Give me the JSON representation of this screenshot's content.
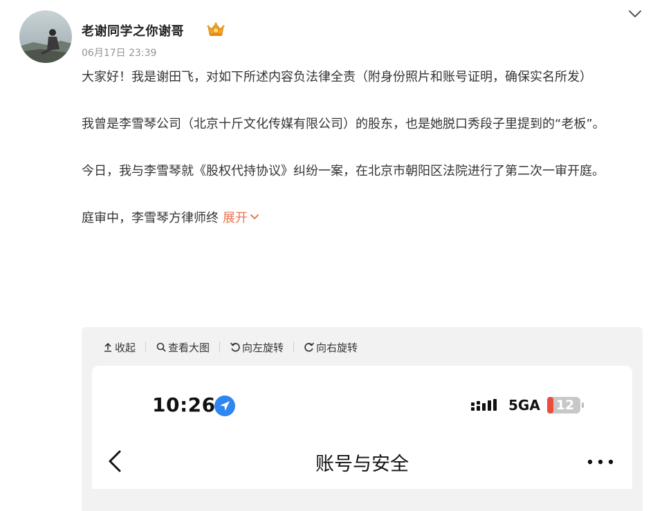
{
  "post": {
    "author": "老谢同学之你谢哥",
    "timestamp": "06月17日 23:39",
    "paragraphs": [
      "大家好！我是谢田飞，对如下所述内容负法律全责（附身份照片和账号证明，确保实名所发）",
      "我曾是李雪琴公司（北京十斤文化传媒有限公司）的股东，也是她脱口秀段子里提到的“老板”。",
      "今日，我与李雪琴就《股权代持协议》纠纷一案，在北京市朝阳区法院进行了第二次一审开庭。",
      "庭审中，李雪琴方律师终"
    ],
    "expand_label": "展开",
    "icons": {
      "badge": "crown-badge-icon",
      "menu": "chevron-down-icon"
    }
  },
  "media_toolbar": {
    "collapse": "收起",
    "view_large": "查看大图",
    "rotate_left": "向左旋转",
    "rotate_right": "向右旋转"
  },
  "phone_screenshot": {
    "time": "10:26",
    "network": "5GA",
    "battery": "12",
    "title": "账号与安全",
    "colors": {
      "location": "#2e86f0",
      "battery": "#eb4d3d"
    }
  },
  "colors": {
    "accent": "#eb7350",
    "timestamp": "#939393",
    "text": "#333333"
  }
}
